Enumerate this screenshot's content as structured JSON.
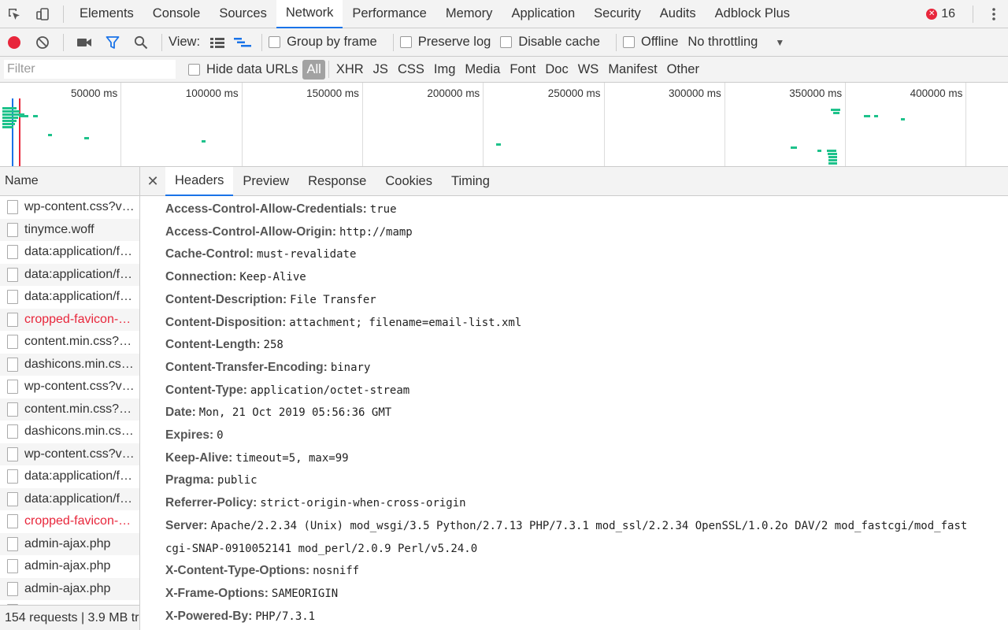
{
  "devtools": {
    "tabs": [
      "Elements",
      "Console",
      "Sources",
      "Network",
      "Performance",
      "Memory",
      "Application",
      "Security",
      "Audits",
      "Adblock Plus"
    ],
    "active_tab": "Network",
    "error_count": "16"
  },
  "toolbar": {
    "view_label": "View:",
    "group_by_frame": "Group by frame",
    "preserve_log": "Preserve log",
    "disable_cache": "Disable cache",
    "offline": "Offline",
    "throttling": "No throttling"
  },
  "filter": {
    "placeholder": "Filter",
    "hide_data_urls": "Hide data URLs",
    "types": [
      "All",
      "XHR",
      "JS",
      "CSS",
      "Img",
      "Media",
      "Font",
      "Doc",
      "WS",
      "Manifest",
      "Other"
    ],
    "active_type": "All"
  },
  "overview": {
    "ticks": [
      "50000 ms",
      "100000 ms",
      "150000 ms",
      "200000 ms",
      "250000 ms",
      "300000 ms",
      "350000 ms",
      "400000 ms"
    ]
  },
  "requests": {
    "column_name": "Name",
    "items": [
      {
        "name": "wp-content.css?ver=5.2.4",
        "error": false
      },
      {
        "name": "tinymce.woff",
        "error": false
      },
      {
        "name": "data:application/font-woff",
        "error": false
      },
      {
        "name": "data:application/font-woff",
        "error": false
      },
      {
        "name": "data:application/font-woff",
        "error": false
      },
      {
        "name": "cropped-favicon-32x32.png",
        "error": true
      },
      {
        "name": "content.min.css?ver=5.2.4",
        "error": false
      },
      {
        "name": "dashicons.min.css?ver=5.2.4",
        "error": false
      },
      {
        "name": "wp-content.css?ver=5.2.4",
        "error": false
      },
      {
        "name": "content.min.css?ver=5.2.4",
        "error": false
      },
      {
        "name": "dashicons.min.css?ver=5.2.4",
        "error": false
      },
      {
        "name": "wp-content.css?ver=5.2.4",
        "error": false
      },
      {
        "name": "data:application/font-woff",
        "error": false
      },
      {
        "name": "data:application/font-woff",
        "error": false
      },
      {
        "name": "cropped-favicon-32x32.png",
        "error": true
      },
      {
        "name": "admin-ajax.php",
        "error": false
      },
      {
        "name": "admin-ajax.php",
        "error": false
      },
      {
        "name": "admin-ajax.php",
        "error": false
      },
      {
        "name": "admin-ajax.php",
        "error": false
      }
    ],
    "status": "154 requests | 3.9 MB transferred"
  },
  "details": {
    "tabs": [
      "Headers",
      "Preview",
      "Response",
      "Cookies",
      "Timing"
    ],
    "active_tab": "Headers",
    "headers": [
      {
        "key": "Access-Control-Allow-Credentials:",
        "value": "true"
      },
      {
        "key": "Access-Control-Allow-Origin:",
        "value": "http://mamp"
      },
      {
        "key": "Cache-Control:",
        "value": "must-revalidate"
      },
      {
        "key": "Connection:",
        "value": "Keep-Alive"
      },
      {
        "key": "Content-Description:",
        "value": "File Transfer"
      },
      {
        "key": "Content-Disposition:",
        "value": "attachment; filename=email-list.xml"
      },
      {
        "key": "Content-Length:",
        "value": "258"
      },
      {
        "key": "Content-Transfer-Encoding:",
        "value": "binary"
      },
      {
        "key": "Content-Type:",
        "value": "application/octet-stream"
      },
      {
        "key": "Date:",
        "value": "Mon, 21 Oct 2019 05:56:36 GMT"
      },
      {
        "key": "Expires:",
        "value": "0"
      },
      {
        "key": "Keep-Alive:",
        "value": "timeout=5, max=99"
      },
      {
        "key": "Pragma:",
        "value": "public"
      },
      {
        "key": "Referrer-Policy:",
        "value": "strict-origin-when-cross-origin"
      },
      {
        "key": "Server:",
        "value": "Apache/2.2.34 (Unix) mod_wsgi/3.5 Python/2.7.13 PHP/7.3.1 mod_ssl/2.2.34 OpenSSL/1.0.2o DAV/2 mod_fastcgi/mod_fast",
        "continuation": "cgi-SNAP-0910052141 mod_perl/2.0.9 Perl/v5.24.0"
      },
      {
        "key": "X-Content-Type-Options:",
        "value": "nosniff"
      },
      {
        "key": "X-Frame-Options:",
        "value": "SAMEORIGIN"
      },
      {
        "key": "X-Powered-By:",
        "value": "PHP/7.3.1"
      }
    ]
  },
  "colors": {
    "accent": "#1a73e8",
    "record": "#e8263b",
    "error_text": "#e8263b",
    "timeline_mark": "#1ec28b"
  }
}
